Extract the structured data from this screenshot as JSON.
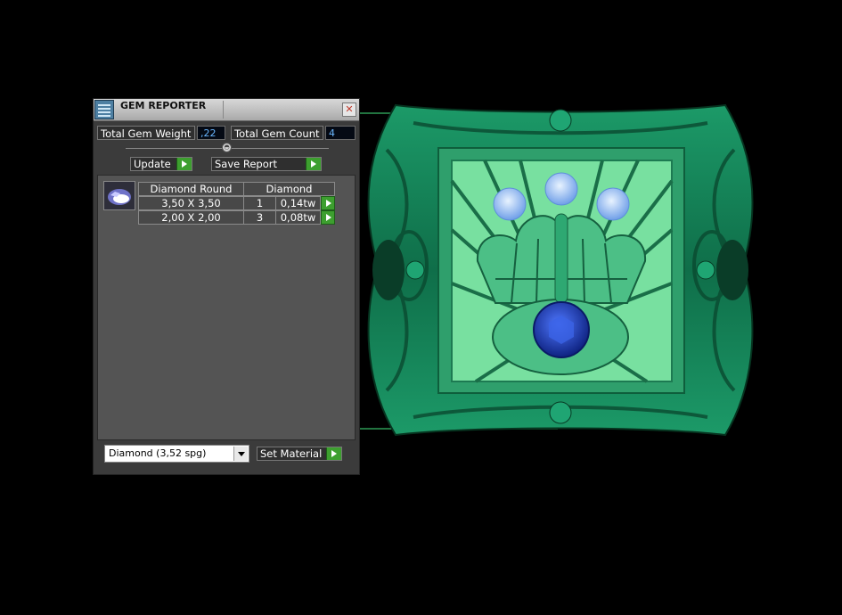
{
  "window": {
    "title": "GEM REPORTER",
    "close_glyph": "✕",
    "icon": "gem-reporter-app-icon"
  },
  "totals": {
    "weight_label": "Total Gem Weight",
    "weight_value": ",22",
    "count_label": "Total Gem Count",
    "count_value": "4"
  },
  "slider": {
    "knob_glyph": "◓"
  },
  "buttons": {
    "update": "Update",
    "save_report": "Save Report",
    "set_material": "Set Material"
  },
  "gem_table": {
    "headers": [
      "Diamond Round",
      "Diamond"
    ],
    "rows": [
      {
        "size": "3,50 X 3,50",
        "count": "1",
        "weight": "0,14tw"
      },
      {
        "size": "2,00 X 2,00",
        "count": "3",
        "weight": "0,08tw"
      }
    ]
  },
  "material": {
    "selected": "Diamond     (3,52 spg)"
  },
  "colors": {
    "accent_green": "#3d9f2f",
    "value_blue": "#6ab7ff",
    "ring_green": "#1f8a5f",
    "sapphire": "#1b3fb8"
  }
}
